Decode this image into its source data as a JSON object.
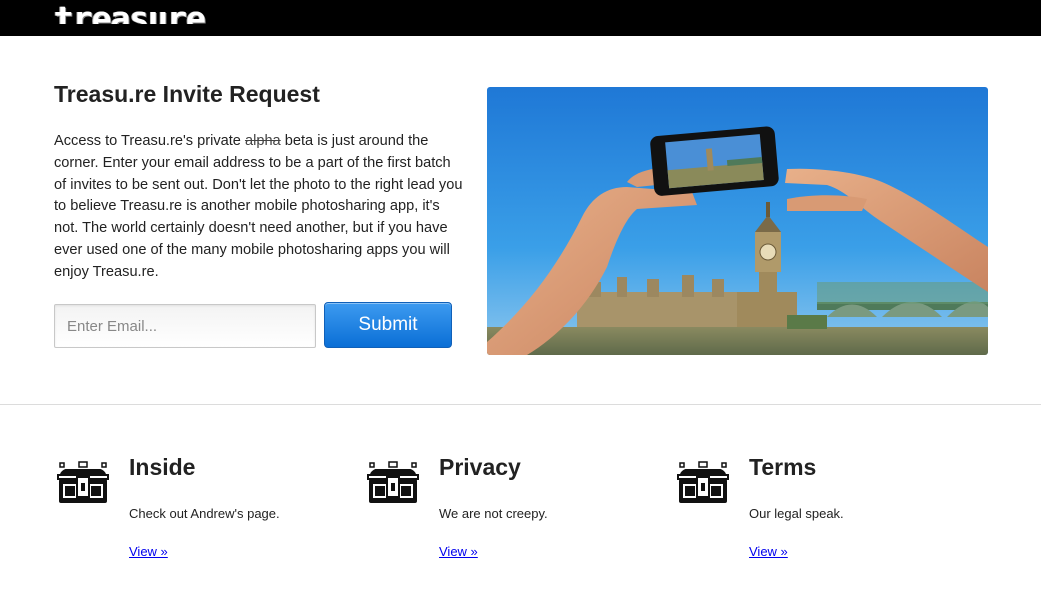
{
  "header": {
    "logo": "treasure"
  },
  "main": {
    "title": "Treasu.re Invite Request",
    "intro_prefix": "Access to Treasu.re's private",
    "intro_struck": "alpha",
    "intro_suffix": "beta is just around the corner. Enter your email address to be a part of the first batch of invites to be sent out. Don't let the photo to the right lead you to believe Treasu.re is another mobile photosharing app, it's not. The world certainly doesn't need another, but if you have ever used one of the many mobile photosharing apps you will enjoy Treasu.re.",
    "email_placeholder": "Enter Email...",
    "email_value": "",
    "submit_label": "Submit"
  },
  "features": [
    {
      "title": "Inside",
      "desc": "Check out Andrew's page.",
      "link": "View »",
      "icon": "treasure-chest-icon"
    },
    {
      "title": "Privacy",
      "desc": "We are not creepy.",
      "link": "View »",
      "icon": "treasure-chest-icon"
    },
    {
      "title": "Terms",
      "desc": "Our legal speak.",
      "link": "View »",
      "icon": "treasure-chest-icon"
    }
  ],
  "colors": {
    "accent": "#0a6fd6",
    "topbar": "#000000",
    "link": "#0000ee"
  }
}
